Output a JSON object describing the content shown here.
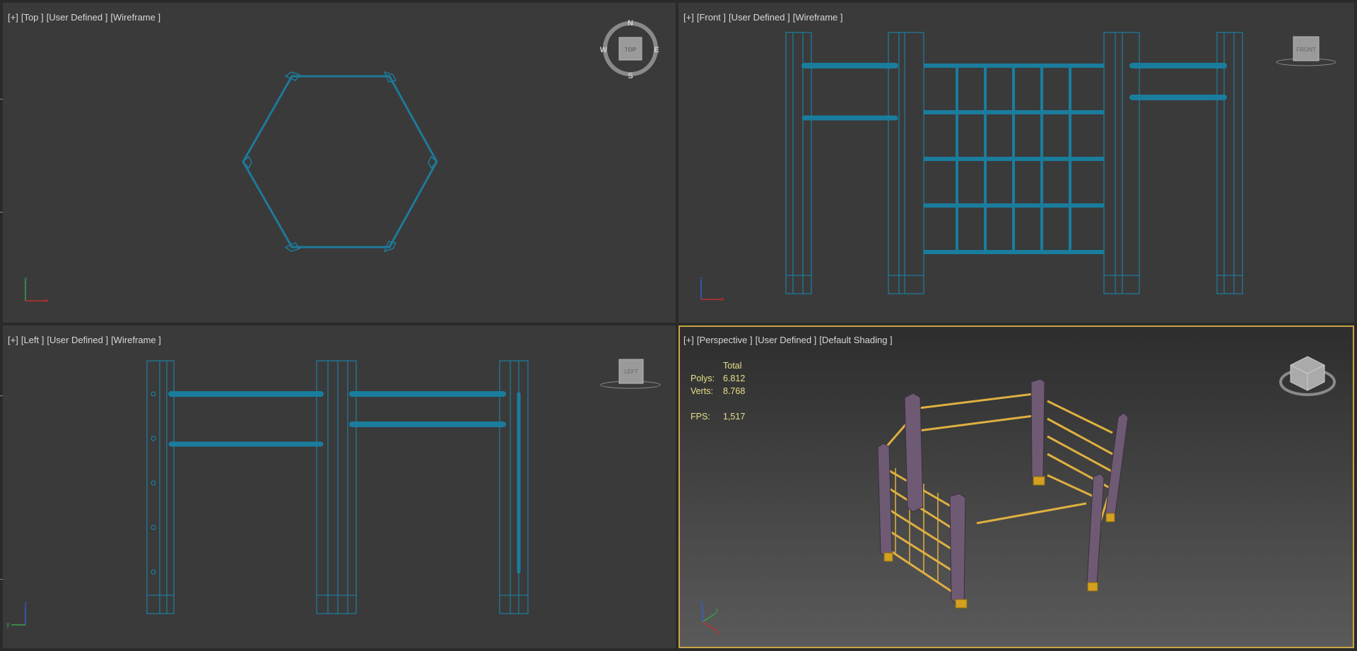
{
  "viewports": {
    "top": {
      "labels": [
        "[+]",
        "[Top ]",
        "[User Defined ]",
        "[Wireframe ]"
      ],
      "compass": {
        "n": "N",
        "s": "S",
        "e": "E",
        "w": "W",
        "cube": "TOP"
      },
      "axes": {
        "a": "y",
        "b": "x"
      }
    },
    "front": {
      "labels": [
        "[+]",
        "[Front ]",
        "[User Defined ]",
        "[Wireframe ]"
      ],
      "cube": "FRONT",
      "axes": {
        "a": "z",
        "b": "x"
      }
    },
    "left": {
      "labels": [
        "[+]",
        "[Left ]",
        "[User Defined ]",
        "[Wireframe ]"
      ],
      "cube": "LEFT",
      "axes": {
        "a": "z",
        "b": "y"
      }
    },
    "perspective": {
      "labels": [
        "[+]",
        "[Perspective ]",
        "[User Defined ]",
        "[Default Shading ]"
      ],
      "axes": {
        "a": "z",
        "b": "y",
        "c": "x"
      }
    }
  },
  "stats": {
    "header": "Total",
    "polys_label": "Polys:",
    "polys_value": "6.812",
    "verts_label": "Verts:",
    "verts_value": "8.768",
    "fps_label": "FPS:",
    "fps_value": "1,517"
  },
  "colors": {
    "wire": "#1e7a9a",
    "active_border": "#c9a545",
    "post": "#6e5a72",
    "rail": "#e0b040",
    "stats_text": "#e8e08a"
  }
}
